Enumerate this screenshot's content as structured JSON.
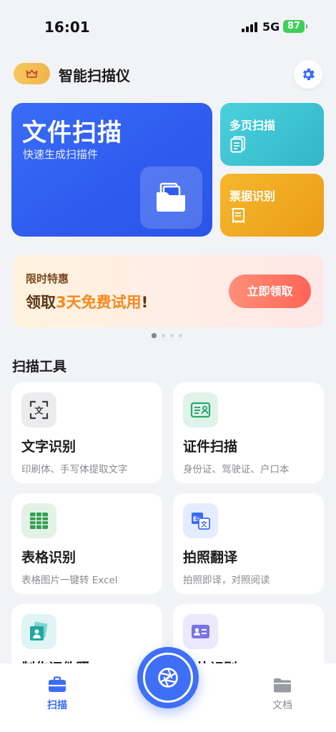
{
  "status_bar": {
    "time": "16:01",
    "network": "5G",
    "battery": "87"
  },
  "header": {
    "title": "智能扫描仪",
    "vip_icon": "crown-icon",
    "settings_icon": "gear-icon"
  },
  "colors": {
    "accent": "#3a6cf6",
    "multi_page": "#30b7c9",
    "receipt": "#eb9c16",
    "promo_button": "#ff6556"
  },
  "hero": {
    "main": {
      "title": "文件扫描",
      "subtitle": "快速生成扫描件",
      "icon": "folder-documents-icon"
    },
    "multi_page": {
      "label": "多页扫描",
      "icon": "document-icon"
    },
    "receipt": {
      "label": "票据识别",
      "icon": "receipt-icon"
    }
  },
  "promo": {
    "tag": "限时特惠",
    "headline_prefix": "领取",
    "headline_highlight": "3天免费试用",
    "headline_suffix": "!",
    "button": "立即领取",
    "page_count": 4,
    "active_page": 1
  },
  "tools_section": {
    "title": "扫描工具",
    "tools": [
      {
        "name": "文字识别",
        "desc": "印刷体、手写体提取文字",
        "icon": "text-scan-icon"
      },
      {
        "name": "证件扫描",
        "desc": "身份证、驾驶证、户口本",
        "icon": "id-card-icon"
      },
      {
        "name": "表格识别",
        "desc": "表格图片一键转 Excel",
        "icon": "table-icon"
      },
      {
        "name": "拍照翻译",
        "desc": "拍照即译，对照阅读",
        "icon": "translate-icon"
      },
      {
        "name": "制作证件照",
        "desc": "",
        "icon": "photo-id-icon"
      },
      {
        "name": "名片识别",
        "desc": "",
        "icon": "business-card-icon"
      }
    ]
  },
  "tabbar": {
    "scan": {
      "label": "扫描",
      "icon": "briefcase-icon"
    },
    "camera": {
      "icon": "camera-shutter-icon"
    },
    "docs": {
      "label": "文档",
      "icon": "folder-icon"
    }
  }
}
